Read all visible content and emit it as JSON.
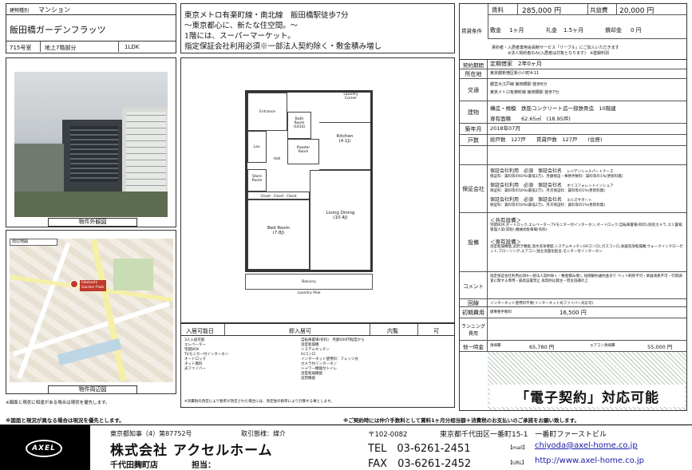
{
  "header": {
    "type_label": "建物種別",
    "type_value": "マンション",
    "building_name": "飯田橋ガーデンフラッツ",
    "room_no": "715号室",
    "floor": "地上7階部分",
    "layout": "1LDK"
  },
  "catch": {
    "line1": "東京メトロ有楽町線・南北線　飯田橋駅徒歩7分",
    "line2": "〜東京都心に、新たな住空間。〜",
    "line3": "1階には、スーパーマーケット。",
    "line4": "指定保証会社利用必須※一部法人契約除く・敷金積み増し"
  },
  "captions": {
    "exterior": "物件外観図",
    "map": "物件周辺図",
    "note_left": "※図面と現状に相違がある場合は現状を優先します。"
  },
  "map": {
    "label": "Iidabashi\nGarden Flats",
    "corner": "周辺地図"
  },
  "floorplan": {
    "rooms": [
      "Laundry\nCorner",
      "Entrance",
      "Bath\nRoom\n(1616)",
      "Powder\nRoom",
      "Kitchen\n(4.1J)",
      "Lav.",
      "Hall",
      "Store\nRoom",
      "Bed Room\n(7.8J)",
      "Living Dining\n(10.4J)",
      "Balcony",
      "Laundry Pole"
    ],
    "closet": "Closet",
    "picture_rail": "Picture Rail"
  },
  "conditions": {
    "rent_label": "賃料",
    "rent": "285,000 円",
    "fee_label": "共益費",
    "fee": "20,000 円",
    "group_label": "賃貸条件",
    "deposit_label": "敷金",
    "deposit": "1ヶ月",
    "key_label": "礼金",
    "key": "1.5ヶ月",
    "amort_label": "償却金",
    "amort": "0 円",
    "note1": "賃約者・入居者専用会員制サービス「リーブル」にご加入いただきます",
    "note2": "※法人契約者のみ(入居者は対象となります)　※登録料別"
  },
  "details": {
    "period_label": "契約期間",
    "period": "定期借家　2年0ヶ月",
    "address_label": "所在地",
    "address": "東京都新宿区新小川町4-11",
    "transport_label": "交通",
    "transport1": "都営大江戸線 飯田橋駅 徒歩6分",
    "transport2": "東京メトロ有楽町線 飯田橋駅 徒歩7分",
    "building_label": "建物",
    "structure": "構造・規模　鉄筋コンクリート造一部鉄骨造　10階建",
    "area": "専有面積　　62.65㎡　(18.95坪)",
    "built_label": "築年月",
    "built": "2018年07月",
    "units_label": "戸数",
    "units": "総戸数　127戸　　賃貸戸数　127戸　　(住居)",
    "guarantee_label": "保証会社",
    "guarantee": [
      {
        "a": "保証会社利用　必須",
        "b": "保証会社名",
        "c": "レジデンシャルパートナーズ",
        "d": "保証料：賃料等の60%(最低3万)、月額保証・事務手数料：賃料等の1%(更新料無)"
      },
      {
        "a": "保証会社利用　必須",
        "b": "保証会社名",
        "c": "オリコフォレントインシュア",
        "d": "保証料：賃料等の50%(最低2万)、月次保証料：賃料等の1%(更新料無)"
      },
      {
        "a": "保証会社利用　必須",
        "b": "保証会社名",
        "c": "エルズサポート",
        "d": "保証料：賃料等の50%(最低2万)、月次保証料：賃料等の1%(更新料無)"
      }
    ],
    "equip_label": "設備",
    "equip_common_title": "＜共有設備＞",
    "equip_common": "宅配BOX,オートロック,エレベーター,TVモニター付インターホン,オートロック,自転車置場(有料),防犯カメラ,ゴミ置場,管理人常(常駐),機械式駐車場(有料)",
    "equip_private_title": "＜専有設備＞",
    "equip_private": "浴室乾燥機能,追焚き機能,温水洗浄便座,システムキッチン(IHコンロ),ガスコンロ,食器洗浄乾燥機,ウォークインクローゼット,フローリング,エアコン,独立洗面化粧台,モニター付インターホン",
    "comment_label": "コメント",
    "comment": "指定保証会社利用必須※一部法人契約除く・敷金積み増し 短期解約違約金あり ペット飼育不可・楽器演奏不可・行政調査に関する専用・器具設置禁止 再契約は貸主・借主協議の上",
    "line_label": "回線",
    "line": "インターネット使用料不要(インターネット光ファイバー対応可)",
    "initial_label": "初期費用",
    "initial_name": "鍵事務手数料",
    "initial_value": "16,500 円",
    "running_label": "ランニング費用",
    "other_label": "他一時金",
    "other1_name": "清掃費",
    "other1_value": "65,780 円",
    "other2_name": "エアコン清掃費",
    "other2_value": "55,000 円"
  },
  "middle": {
    "move_label": "入居可能日",
    "move_value": "即入居可",
    "viewing_label": "内覧",
    "viewing_value": "可",
    "equip_list1": "3人入居可能\nエレベーター\n宅配BOX\nTVモニター付インターホン\nオートロック\nネット無料\n光ファイバー",
    "equip_list2": "自転車置場(有料)　月額500円程度から\n浴室乾燥機\nシステムキッチン\nIHコンロ\nインターネット使用料：フレッツ光\nカメラ付インターホン\nシャワー機能付トイレ\n浴室乾燥機能\n追焚機能",
    "tax_note": "※消費税の改定により税率が改定された場合には、改定後の税率により計算する事とします。"
  },
  "electronic": "「電子契約」対応可能",
  "bottom_note_left": "※図面と現況が異なる場合は現況を優先とします。",
  "bottom_note_right": "※ご契約時には仲介手数料として賃料1ヶ月分相当額＋消費税のお支払いのご承諾をお願い致します。",
  "footer": {
    "license": "東京都知事（4）第87752号",
    "type": "取引態様：媒介",
    "company": "株式会社 アクセルホーム",
    "branch": "千代田麹町店",
    "person": "担当：",
    "postal": "〒102-0082",
    "address": "東京都千代田区一番町15-1　一番町ファーストビル",
    "tel": "TEL　03-6261-2451",
    "mail_label": "【mail】",
    "mail": "chiyoda@axel-home.co.jp",
    "fax": "FAX　03-6261-2452",
    "url_label": "【URL】",
    "url": "http://www.axel-home.co.jp",
    "logo": "AXEL"
  },
  "colors": {
    "footer_bg": "#000000",
    "link": "#1a1aa8"
  }
}
